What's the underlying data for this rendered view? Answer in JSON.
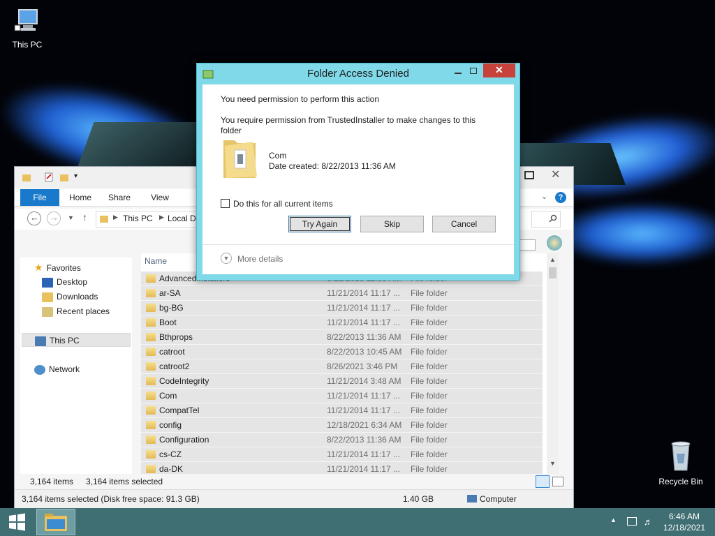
{
  "desktop": {
    "icons": [
      {
        "label": "This PC",
        "icon": "computer-icon"
      },
      {
        "label": "Recycle Bin",
        "icon": "recycle-bin-icon"
      }
    ]
  },
  "explorer": {
    "ribbon_tabs": [
      "File",
      "Home",
      "Share",
      "View"
    ],
    "address_parts": [
      "This PC",
      "Local Di"
    ],
    "nav": {
      "favorites": "Favorites",
      "desktop": "Desktop",
      "downloads": "Downloads",
      "recent": "Recent places",
      "this_pc": "This PC",
      "network": "Network"
    },
    "column_name": "Name",
    "rows": [
      {
        "name": "AdvancedInstallers",
        "date": "8/22/2013 11:36 AM",
        "type": "File folder"
      },
      {
        "name": "ar-SA",
        "date": "11/21/2014 11:17 ...",
        "type": "File folder"
      },
      {
        "name": "bg-BG",
        "date": "11/21/2014 11:17 ...",
        "type": "File folder"
      },
      {
        "name": "Boot",
        "date": "11/21/2014 11:17 ...",
        "type": "File folder"
      },
      {
        "name": "Bthprops",
        "date": "8/22/2013 11:36 AM",
        "type": "File folder"
      },
      {
        "name": "catroot",
        "date": "8/22/2013 10:45 AM",
        "type": "File folder"
      },
      {
        "name": "catroot2",
        "date": "8/26/2021 3:46 PM",
        "type": "File folder"
      },
      {
        "name": "CodeIntegrity",
        "date": "11/21/2014 3:48 AM",
        "type": "File folder"
      },
      {
        "name": "Com",
        "date": "11/21/2014 11:17 ...",
        "type": "File folder"
      },
      {
        "name": "CompatTel",
        "date": "11/21/2014 11:17 ...",
        "type": "File folder"
      },
      {
        "name": "config",
        "date": "12/18/2021 6:34 AM",
        "type": "File folder"
      },
      {
        "name": "Configuration",
        "date": "8/22/2013 11:36 AM",
        "type": "File folder"
      },
      {
        "name": "cs-CZ",
        "date": "11/21/2014 11:17 ...",
        "type": "File folder"
      },
      {
        "name": "da-DK",
        "date": "11/21/2014 11:17 ...",
        "type": "File folder"
      }
    ],
    "status_count": "3,164 items",
    "status_selected": "3,164 items selected",
    "details": "3,164 items selected (Disk free space: 91.3 GB)",
    "size": "1.40 GB",
    "location": "Computer"
  },
  "dialog": {
    "title": "Folder Access Denied",
    "heading": "You need permission to perform this action",
    "message": "You require permission from TrustedInstaller to make changes to this folder",
    "folder_name": "Com",
    "date_created": "Date created: 8/22/2013 11:36 AM",
    "checkbox_label": "Do this for all current items",
    "try_again": "Try Again",
    "skip": "Skip",
    "cancel": "Cancel",
    "more_details": "More details"
  },
  "taskbar": {
    "time": "6:46 AM",
    "date": "12/18/2021"
  },
  "colors": {
    "dialog_frame": "#7fd9e8",
    "taskbar": "#3f6e73",
    "file_tab": "#1979ca",
    "close_button": "#c7423a"
  }
}
